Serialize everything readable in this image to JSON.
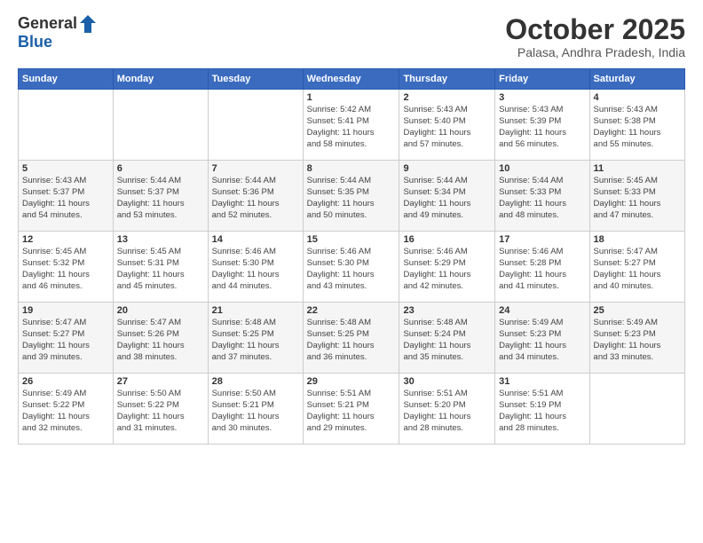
{
  "header": {
    "logo": {
      "line1": "General",
      "line2": "Blue"
    },
    "title": "October 2025",
    "location": "Palasa, Andhra Pradesh, India"
  },
  "weekdays": [
    "Sunday",
    "Monday",
    "Tuesday",
    "Wednesday",
    "Thursday",
    "Friday",
    "Saturday"
  ],
  "weeks": [
    [
      {
        "day": "",
        "info": ""
      },
      {
        "day": "",
        "info": ""
      },
      {
        "day": "",
        "info": ""
      },
      {
        "day": "1",
        "info": "Sunrise: 5:42 AM\nSunset: 5:41 PM\nDaylight: 11 hours\nand 58 minutes."
      },
      {
        "day": "2",
        "info": "Sunrise: 5:43 AM\nSunset: 5:40 PM\nDaylight: 11 hours\nand 57 minutes."
      },
      {
        "day": "3",
        "info": "Sunrise: 5:43 AM\nSunset: 5:39 PM\nDaylight: 11 hours\nand 56 minutes."
      },
      {
        "day": "4",
        "info": "Sunrise: 5:43 AM\nSunset: 5:38 PM\nDaylight: 11 hours\nand 55 minutes."
      }
    ],
    [
      {
        "day": "5",
        "info": "Sunrise: 5:43 AM\nSunset: 5:37 PM\nDaylight: 11 hours\nand 54 minutes."
      },
      {
        "day": "6",
        "info": "Sunrise: 5:44 AM\nSunset: 5:37 PM\nDaylight: 11 hours\nand 53 minutes."
      },
      {
        "day": "7",
        "info": "Sunrise: 5:44 AM\nSunset: 5:36 PM\nDaylight: 11 hours\nand 52 minutes."
      },
      {
        "day": "8",
        "info": "Sunrise: 5:44 AM\nSunset: 5:35 PM\nDaylight: 11 hours\nand 50 minutes."
      },
      {
        "day": "9",
        "info": "Sunrise: 5:44 AM\nSunset: 5:34 PM\nDaylight: 11 hours\nand 49 minutes."
      },
      {
        "day": "10",
        "info": "Sunrise: 5:44 AM\nSunset: 5:33 PM\nDaylight: 11 hours\nand 48 minutes."
      },
      {
        "day": "11",
        "info": "Sunrise: 5:45 AM\nSunset: 5:33 PM\nDaylight: 11 hours\nand 47 minutes."
      }
    ],
    [
      {
        "day": "12",
        "info": "Sunrise: 5:45 AM\nSunset: 5:32 PM\nDaylight: 11 hours\nand 46 minutes."
      },
      {
        "day": "13",
        "info": "Sunrise: 5:45 AM\nSunset: 5:31 PM\nDaylight: 11 hours\nand 45 minutes."
      },
      {
        "day": "14",
        "info": "Sunrise: 5:46 AM\nSunset: 5:30 PM\nDaylight: 11 hours\nand 44 minutes."
      },
      {
        "day": "15",
        "info": "Sunrise: 5:46 AM\nSunset: 5:30 PM\nDaylight: 11 hours\nand 43 minutes."
      },
      {
        "day": "16",
        "info": "Sunrise: 5:46 AM\nSunset: 5:29 PM\nDaylight: 11 hours\nand 42 minutes."
      },
      {
        "day": "17",
        "info": "Sunrise: 5:46 AM\nSunset: 5:28 PM\nDaylight: 11 hours\nand 41 minutes."
      },
      {
        "day": "18",
        "info": "Sunrise: 5:47 AM\nSunset: 5:27 PM\nDaylight: 11 hours\nand 40 minutes."
      }
    ],
    [
      {
        "day": "19",
        "info": "Sunrise: 5:47 AM\nSunset: 5:27 PM\nDaylight: 11 hours\nand 39 minutes."
      },
      {
        "day": "20",
        "info": "Sunrise: 5:47 AM\nSunset: 5:26 PM\nDaylight: 11 hours\nand 38 minutes."
      },
      {
        "day": "21",
        "info": "Sunrise: 5:48 AM\nSunset: 5:25 PM\nDaylight: 11 hours\nand 37 minutes."
      },
      {
        "day": "22",
        "info": "Sunrise: 5:48 AM\nSunset: 5:25 PM\nDaylight: 11 hours\nand 36 minutes."
      },
      {
        "day": "23",
        "info": "Sunrise: 5:48 AM\nSunset: 5:24 PM\nDaylight: 11 hours\nand 35 minutes."
      },
      {
        "day": "24",
        "info": "Sunrise: 5:49 AM\nSunset: 5:23 PM\nDaylight: 11 hours\nand 34 minutes."
      },
      {
        "day": "25",
        "info": "Sunrise: 5:49 AM\nSunset: 5:23 PM\nDaylight: 11 hours\nand 33 minutes."
      }
    ],
    [
      {
        "day": "26",
        "info": "Sunrise: 5:49 AM\nSunset: 5:22 PM\nDaylight: 11 hours\nand 32 minutes."
      },
      {
        "day": "27",
        "info": "Sunrise: 5:50 AM\nSunset: 5:22 PM\nDaylight: 11 hours\nand 31 minutes."
      },
      {
        "day": "28",
        "info": "Sunrise: 5:50 AM\nSunset: 5:21 PM\nDaylight: 11 hours\nand 30 minutes."
      },
      {
        "day": "29",
        "info": "Sunrise: 5:51 AM\nSunset: 5:21 PM\nDaylight: 11 hours\nand 29 minutes."
      },
      {
        "day": "30",
        "info": "Sunrise: 5:51 AM\nSunset: 5:20 PM\nDaylight: 11 hours\nand 28 minutes."
      },
      {
        "day": "31",
        "info": "Sunrise: 5:51 AM\nSunset: 5:19 PM\nDaylight: 11 hours\nand 28 minutes."
      },
      {
        "day": "",
        "info": ""
      }
    ]
  ]
}
